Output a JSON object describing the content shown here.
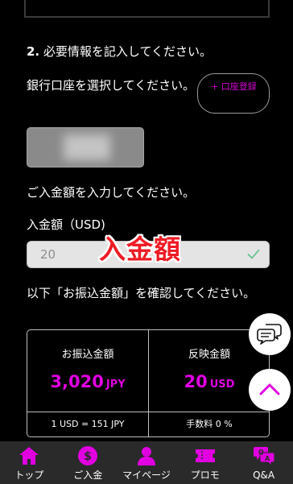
{
  "step": {
    "number": "2.",
    "title": "必要情報を記入してください。"
  },
  "bank": {
    "label": "銀行口座を選択してください。",
    "add_button": "+ 口座登録"
  },
  "deposit": {
    "prompt": "ご入金額を入力してください。",
    "amount_label": "入金額（USD)",
    "amount_value": "20",
    "overlay_label": "入金額"
  },
  "confirm": {
    "text": "以下「お振込金額」を確認してください。"
  },
  "summary": {
    "transfer_label": "お振込金額",
    "transfer_value": "3,020",
    "transfer_currency": "JPY",
    "reflect_label": "反映金額",
    "reflect_value": "20",
    "reflect_currency": "USD",
    "rate": "1 USD = 151 JPY",
    "fee": "手数料 0 %"
  },
  "nav": {
    "items": [
      {
        "label": "トップ",
        "icon": "home-icon"
      },
      {
        "label": "ご入金",
        "icon": "coin-icon"
      },
      {
        "label": "マイページ",
        "icon": "user-icon"
      },
      {
        "label": "プロモ",
        "icon": "ticket-icon"
      },
      {
        "label": "Q&A",
        "icon": "qa-icon"
      }
    ]
  },
  "colors": {
    "accent": "#e000e0",
    "overlay_red": "#ee1b24",
    "background": "#000000",
    "nav_background": "#2a2a2a"
  }
}
